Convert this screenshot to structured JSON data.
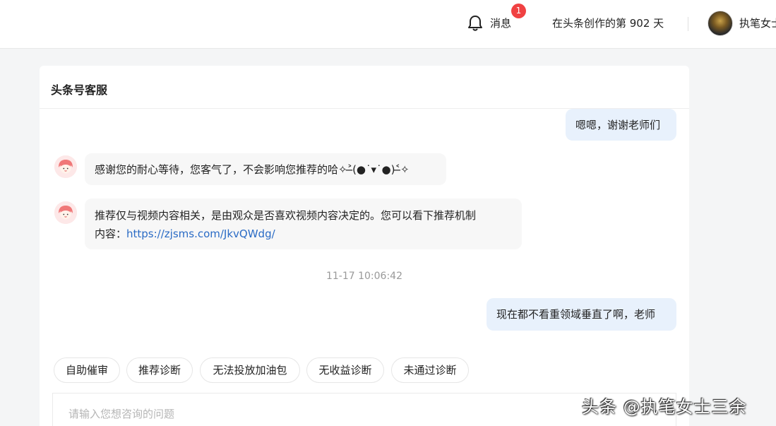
{
  "header": {
    "messages_label": "消息",
    "messages_badge": "1",
    "days_text": "在头条创作的第 902 天",
    "user_name": "执笔女士"
  },
  "chat": {
    "title": "头条号客服",
    "messages": [
      {
        "from": "user",
        "text": "嗯嗯，谢谢老师们"
      },
      {
        "from": "agent",
        "text": "感谢您的耐心等待，您客气了，不会影响您推荐的哈✧˃̶(●˙▾˙●)˂̶✧"
      },
      {
        "from": "agent",
        "line1": "推荐仅与视频内容相关，是由观众是否喜欢视频内容决定的。您可以看下推荐机制",
        "line2_prefix": "内容：",
        "link": "https://zjsms.com/JkvQWdg/"
      },
      {
        "from": "user",
        "text": "现在都不看重领域垂直了啊，老师"
      }
    ],
    "timestamp": "11-17 10:06:42"
  },
  "quick_actions": [
    "自助催审",
    "推荐诊断",
    "无法投放加油包",
    "无收益诊断",
    "未通过诊断"
  ],
  "input": {
    "placeholder": "请输入您想咨询的问题",
    "value": ""
  },
  "watermark": "头条 @执笔女士三余",
  "colors": {
    "badge": "#f04142",
    "user_bubble": "#e8f1fc",
    "agent_bubble": "#f7f7f7",
    "link": "#2a6bc5"
  },
  "icons": {
    "bell": "bell-icon",
    "agent_avatar": "customer-service-avatar-icon"
  }
}
